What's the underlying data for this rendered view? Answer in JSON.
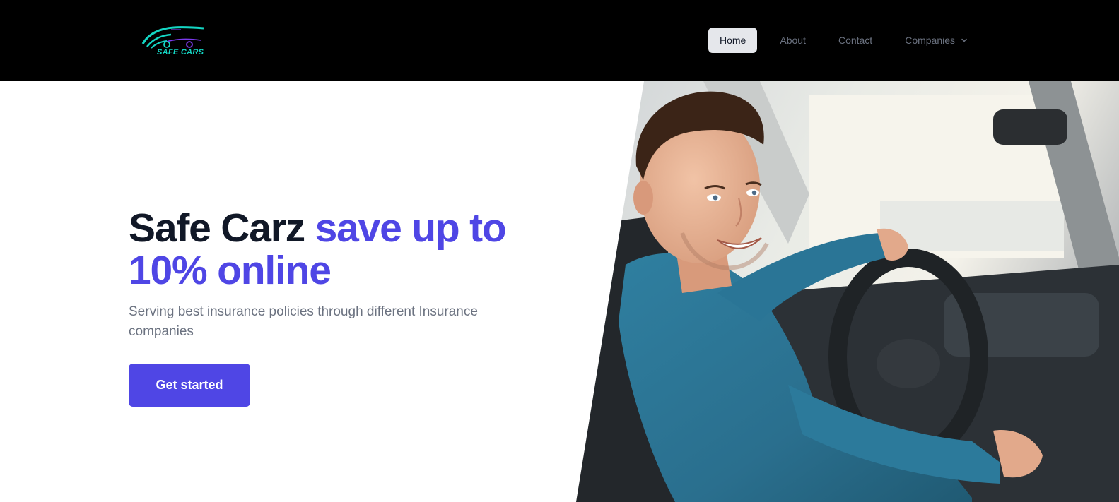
{
  "brand": {
    "logo_text": "SAFE CARS",
    "logo_colors": [
      "#14d6c4",
      "#7c3aed"
    ]
  },
  "nav": {
    "items": [
      {
        "label": "Home",
        "active": true
      },
      {
        "label": "About",
        "active": false
      },
      {
        "label": "Contact",
        "active": false
      },
      {
        "label": "Companies",
        "active": false,
        "dropdown": true
      }
    ]
  },
  "hero": {
    "headline_main": "Safe Carz ",
    "headline_accent": "save up to 10% online",
    "subtext": "Serving best insurance policies through different Insurance companies",
    "cta_label": "Get started",
    "image": "smiling-man-driving-car-photo"
  },
  "colors": {
    "accent": "#4f46e5",
    "navbar_bg": "#000000",
    "heading": "#111827",
    "muted": "#6b7280"
  }
}
